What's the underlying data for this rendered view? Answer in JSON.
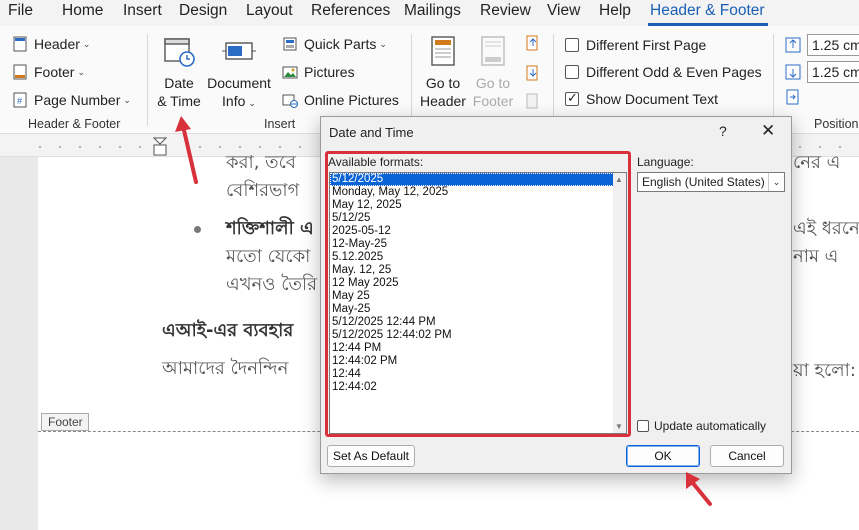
{
  "menu": {
    "items": [
      "File",
      "Home",
      "Insert",
      "Design",
      "Layout",
      "References",
      "Mailings",
      "Review",
      "View",
      "Help"
    ],
    "active": "Header & Footer"
  },
  "ribbon": {
    "header_footer_group": {
      "header": "Header",
      "footer": "Footer",
      "page_number": "Page Number",
      "label": "Header & Footer"
    },
    "insert_group": {
      "date_time_line1": "Date",
      "date_time_line2": "& Time",
      "document_info_line1": "Document",
      "document_info_line2": "Info",
      "quick_parts": "Quick Parts",
      "pictures": "Pictures",
      "online_pictures": "Online Pictures",
      "label": "Insert"
    },
    "navigation_group": {
      "go_to_header_line1": "Go to",
      "go_to_header_line2": "Header",
      "go_to_footer_line1": "Go to",
      "go_to_footer_line2": "Footer"
    },
    "options_group": {
      "different_first_page": "Different First Page",
      "different_odd_even": "Different Odd & Even Pages",
      "show_document_text": "Show Document Text"
    },
    "position_group": {
      "header_from_top": "1.25 cm",
      "footer_from_bottom": "1.25 cm",
      "label": "Position"
    }
  },
  "document": {
    "line1": "করা, তবে",
    "line2": "বেশিরভাগ",
    "bullet_bold": "শক্তিশালী এ",
    "bullet_line2": "মতো যেকো",
    "bullet_line3": "এখনও তৈরি",
    "right1": "নের এ",
    "right2": "এই ধরনে",
    "right3": "নাম এ",
    "heading": "এআই-এর ব্যবহার",
    "para": "আমাদের দৈনন্দিন",
    "para_right": "য়া হলো:",
    "footer_tag": "Footer"
  },
  "dialog": {
    "title": "Date and Time",
    "help": "?",
    "close": "✕",
    "available_formats_label": "Available formats:",
    "formats": [
      "5/12/2025",
      "Monday, May 12, 2025",
      "May 12, 2025",
      "5/12/25",
      "2025-05-12",
      "12-May-25",
      "5.12.2025",
      "May. 12, 25",
      "12 May 2025",
      "May 25",
      "May-25",
      "5/12/2025 12:44 PM",
      "5/12/2025 12:44:02 PM",
      "12:44 PM",
      "12:44:02 PM",
      "12:44",
      "12:44:02"
    ],
    "selected_index": 0,
    "language_label": "Language:",
    "language_value": "English (United States)",
    "update_automatically": "Update automatically",
    "set_as_default": "Set As Default",
    "ok": "OK",
    "cancel": "Cancel"
  },
  "colors": {
    "accent": "#1a5fb4",
    "highlight_box": "#d8313c",
    "selection": "#0a64d8"
  }
}
